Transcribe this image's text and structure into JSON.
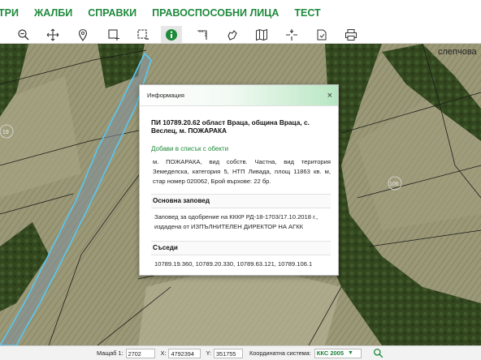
{
  "menu": {
    "items": [
      "ТРИ",
      "ЖАЛБИ",
      "СПРАВКИ",
      "ПРАВОСПОСОБНИ ЛИЦА",
      "ТЕСТ"
    ]
  },
  "toolbar": {
    "tools": [
      {
        "icon": "zoom-out-icon"
      },
      {
        "icon": "pan-icon"
      },
      {
        "icon": "location-pin-icon"
      },
      {
        "icon": "select-area-icon"
      },
      {
        "icon": "select-area-alt-icon"
      },
      {
        "icon": "info-icon",
        "active": true
      },
      {
        "icon": "measure-icon"
      },
      {
        "icon": "hand-icon"
      },
      {
        "icon": "map-icon"
      },
      {
        "icon": "crosshair-icon"
      },
      {
        "icon": "export-icon"
      },
      {
        "icon": "print-icon"
      }
    ]
  },
  "map": {
    "place_label": "слепчова"
  },
  "dialog": {
    "title": "Информация",
    "close_glyph": "×",
    "parcel_title": "ПИ 10789.20.62 област Враца, община Враца, с. Веслец, м. ПОЖАРАКА",
    "add_link": "Добави в списък с обекти",
    "description": "м. ПОЖАРАКА, вид собств. Частна, вид територия Земеделска, категория 5, НТП Ливада, площ 11863 кв. м, стар номер 020062, Брой върхове: 22 бр.",
    "order_heading": "Основна заповед",
    "order_text": "Заповед за одобрение на КККР РД-18-1703/17.10.2018 г., издадена от ИЗПЪЛНИТЕЛЕН ДИРЕКТОР НА АГКК",
    "neighbors_heading": "Съседи",
    "neighbors_text": "10789.19.360, 10789.20.330, 10789.63.121, 10789.106.1"
  },
  "statusbar": {
    "scale_label": "Мащаб 1:",
    "scale_value": "2702",
    "x_label": "X:",
    "x_value": "4792394",
    "y_label": "Y:",
    "y_value": "351755",
    "crs_label": "Координатна система:",
    "crs_value": "ККС 2005",
    "dropdown_glyph": "▼",
    "search_icon": "search-icon"
  },
  "colors": {
    "accent": "#1e8a3c",
    "parcel_outline": "#5ac8f0",
    "dialog_header_end": "#b7e6c2"
  }
}
